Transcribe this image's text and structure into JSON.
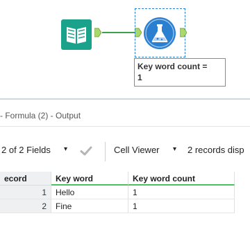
{
  "canvas": {
    "annotation": "Key word count =\n1"
  },
  "panel": {
    "title": "- Formula (2) - Output",
    "toolbar": {
      "fields_label": "2 of 2 Fields",
      "fields_caret": "▾",
      "cell_viewer_label": "Cell Viewer",
      "cell_viewer_caret": "▾",
      "records_label": "2 records disp"
    },
    "table": {
      "headers": [
        "ecord",
        "Key word",
        "Key word count"
      ],
      "rows": [
        [
          "1",
          "Hello",
          "1"
        ],
        [
          "2",
          "Fine",
          "1"
        ]
      ]
    }
  },
  "colors": {
    "input_tool": "#1aa38a",
    "formula_tool": "#2a7fd1",
    "connector": "#3aa34a",
    "anchor": "#a9d96a",
    "header_underline": "#4cc25f"
  },
  "icons": {
    "input_tool": "book-icon",
    "formula_tool": "flask-icon",
    "apply": "checkmark-icon"
  }
}
